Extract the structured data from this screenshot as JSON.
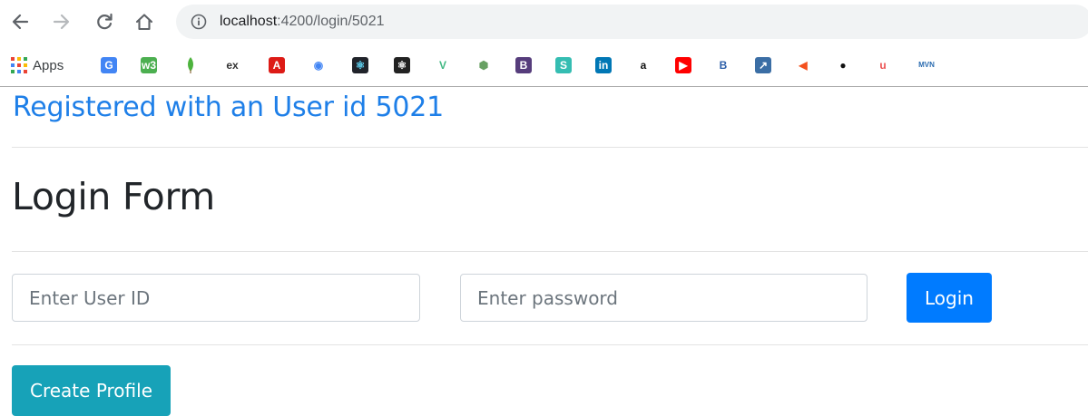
{
  "browser": {
    "url_host": "localhost",
    "url_path": ":4200/login/5021",
    "bookmarks_apps_label": "Apps",
    "bookmarks": [
      {
        "name": "google",
        "glyph": "G",
        "color": "#4285f4",
        "fg": "#ffffff"
      },
      {
        "name": "w3schools",
        "glyph": "w3",
        "color": "#4caf50",
        "fg": "#ffffff"
      },
      {
        "name": "mongodb",
        "glyph": "",
        "color": "#4db33d",
        "fg": "#ffffff"
      },
      {
        "name": "express",
        "glyph": "ex",
        "color": "#ffffff",
        "fg": "#333333"
      },
      {
        "name": "angular",
        "glyph": "A",
        "color": "#dd1b16",
        "fg": "#ffffff"
      },
      {
        "name": "chromium",
        "glyph": "◉",
        "color": "#ffffff",
        "fg": "#4285f4"
      },
      {
        "name": "react",
        "glyph": "⚛",
        "color": "#20232a",
        "fg": "#61dafb"
      },
      {
        "name": "react-native",
        "glyph": "⚛",
        "color": "#222222",
        "fg": "#ffffff"
      },
      {
        "name": "vue",
        "glyph": "V",
        "color": "#ffffff",
        "fg": "#41b883"
      },
      {
        "name": "nodejs",
        "glyph": "⬢",
        "color": "#ffffff",
        "fg": "#68a063"
      },
      {
        "name": "bootstrap",
        "glyph": "B",
        "color": "#563d7c",
        "fg": "#ffffff"
      },
      {
        "name": "semantic",
        "glyph": "S",
        "color": "#35bdb2",
        "fg": "#ffffff"
      },
      {
        "name": "linkedin",
        "glyph": "in",
        "color": "#0077b5",
        "fg": "#ffffff"
      },
      {
        "name": "amazon",
        "glyph": "a",
        "color": "#ffffff",
        "fg": "#111111"
      },
      {
        "name": "youtube",
        "glyph": "▶",
        "color": "#ff0000",
        "fg": "#ffffff"
      },
      {
        "name": "bookmark-b",
        "glyph": "B",
        "color": "#ffffff",
        "fg": "#2d5fa8"
      },
      {
        "name": "bookmark-chart",
        "glyph": "↗",
        "color": "#3b6ea5",
        "fg": "#ffffff"
      },
      {
        "name": "bookmark-chevron",
        "glyph": "◀",
        "color": "#ffffff",
        "fg": "#f4511e"
      },
      {
        "name": "github",
        "glyph": "●",
        "color": "#ffffff",
        "fg": "#111111"
      },
      {
        "name": "udemy",
        "glyph": "u",
        "color": "#ffffff",
        "fg": "#ec5252"
      },
      {
        "name": "mvn",
        "glyph": "MVN",
        "color": "#ffffff",
        "fg": "#2b6cb0"
      }
    ]
  },
  "page": {
    "registered_banner": "Registered with an User id 5021",
    "title": "Login Form",
    "user_id_placeholder": "Enter User ID",
    "password_placeholder": "Enter password",
    "login_label": "Login",
    "create_profile_label": "Create Profile"
  },
  "colors": {
    "banner": "#1e7fe8",
    "login_button": "#007bff",
    "create_button": "#17a2b8"
  }
}
